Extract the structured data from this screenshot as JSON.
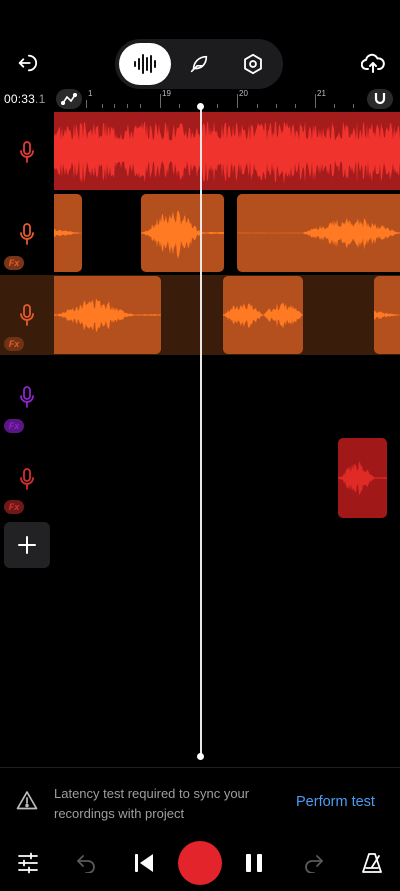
{
  "header": {
    "back_icon": "exit-icon",
    "modes": [
      "waveform-icon",
      "feather-icon",
      "settings-hexagon-icon"
    ],
    "active_mode": 0,
    "upload_icon": "cloud-upload-icon"
  },
  "ruler": {
    "time_main": "00:33",
    "time_frac": ".1",
    "bar_numbers": [
      "1",
      "19",
      "20",
      "21"
    ],
    "snap_icon": "magnet-icon",
    "loop_icon": "loop-icon"
  },
  "tracks": [
    {
      "mic_color": "#e53935",
      "fx": false,
      "fx_color": "",
      "selected": false
    },
    {
      "mic_color": "#e65a2c",
      "fx": true,
      "fx_label": "Fx",
      "fx_color": "#7a3417"
    },
    {
      "mic_color": "#e65a2c",
      "fx": true,
      "fx_label": "Fx",
      "fx_color": "#6e3214",
      "selected": true
    },
    {
      "mic_color": "#8e24cc",
      "fx": true,
      "fx_label": "Fx",
      "fx_color": "#5a1682"
    },
    {
      "mic_color": "#d32f2f",
      "fx": true,
      "fx_label": "Fx",
      "fx_color": "#6e1818"
    }
  ],
  "colors": {
    "red_clip_bg": "#a51c1c",
    "red_wave": "#f0332d",
    "orange_clip_bg": "#b4501e",
    "orange_wave": "#ff7a22",
    "selected_track_bg": "#3a1c0a",
    "accent_link": "#4a9ef2",
    "record": "#e3242b"
  },
  "banner": {
    "warning_icon": "warning-triangle-icon",
    "message": "Latency test required to sync your recordings with project",
    "action": "Perform test"
  },
  "transport": {
    "icons": [
      "mixer-sliders-icon",
      "undo-icon",
      "skip-to-start-icon",
      "record-button",
      "pause-icon",
      "redo-icon",
      "metronome-icon"
    ]
  }
}
